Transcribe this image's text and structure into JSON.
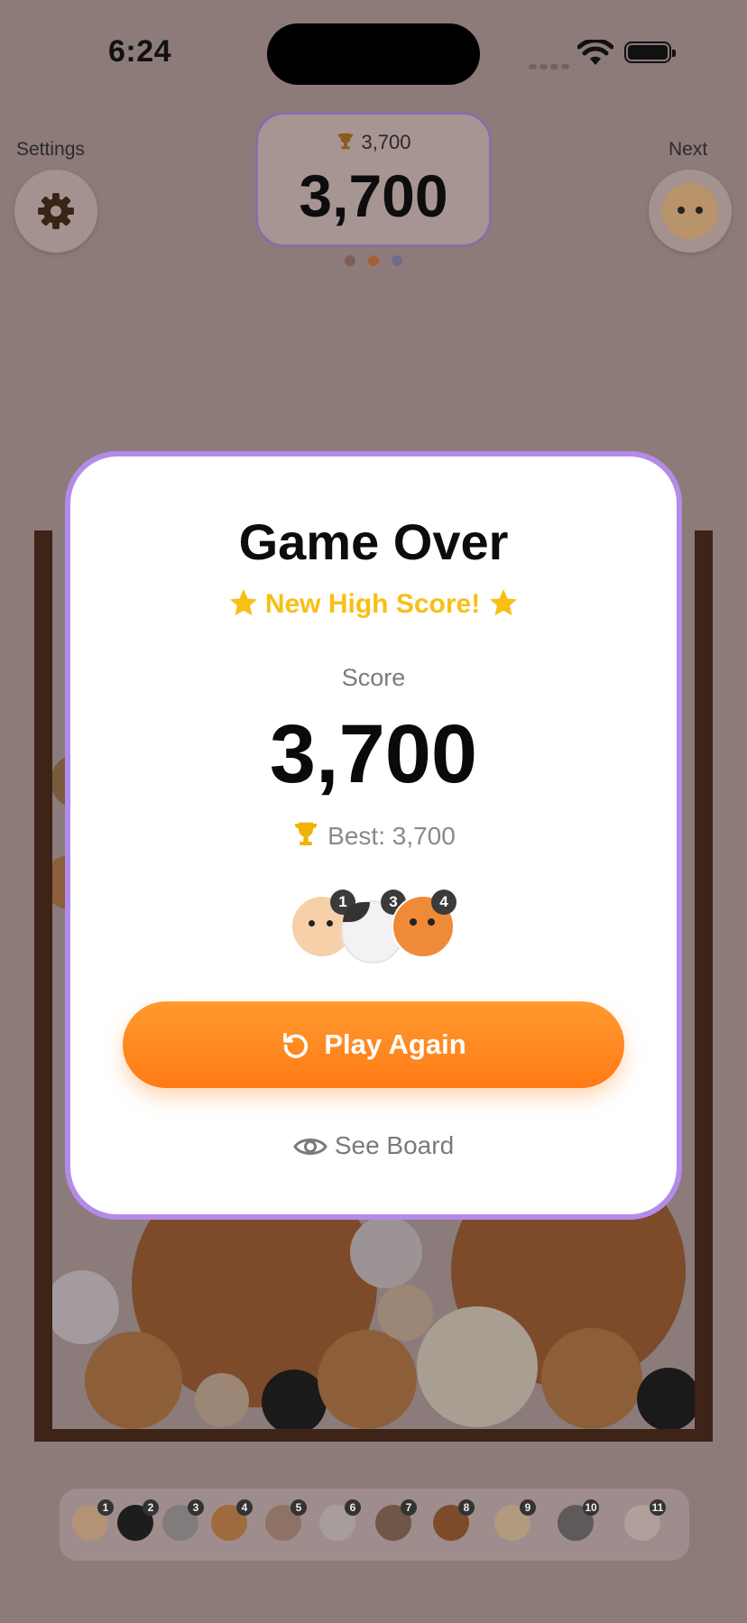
{
  "status_bar": {
    "time": "6:24"
  },
  "header": {
    "settings_label": "Settings",
    "next_label": "Next",
    "best_small": "3,700",
    "score_big": "3,700"
  },
  "modal": {
    "title": "Game Over",
    "high_score_text": "New High Score!",
    "score_label": "Score",
    "score_value": "3,700",
    "best_label": "Best: 3,700",
    "unlocked_badges": [
      "1",
      "3",
      "4"
    ],
    "play_again_label": "Play Again",
    "see_board_label": "See Board"
  },
  "evolution_strip": {
    "levels": [
      "1",
      "2",
      "3",
      "4",
      "5",
      "6",
      "7",
      "8",
      "9",
      "10",
      "11"
    ]
  },
  "colors": {
    "accent_orange": "#ff8a20",
    "high_score_yellow": "#f8bf14",
    "modal_border_purple": "#b48be8"
  },
  "icons": {
    "settings": "gear-icon",
    "trophy": "trophy-icon",
    "star": "star-icon",
    "replay": "replay-icon",
    "eye": "eye-icon"
  }
}
